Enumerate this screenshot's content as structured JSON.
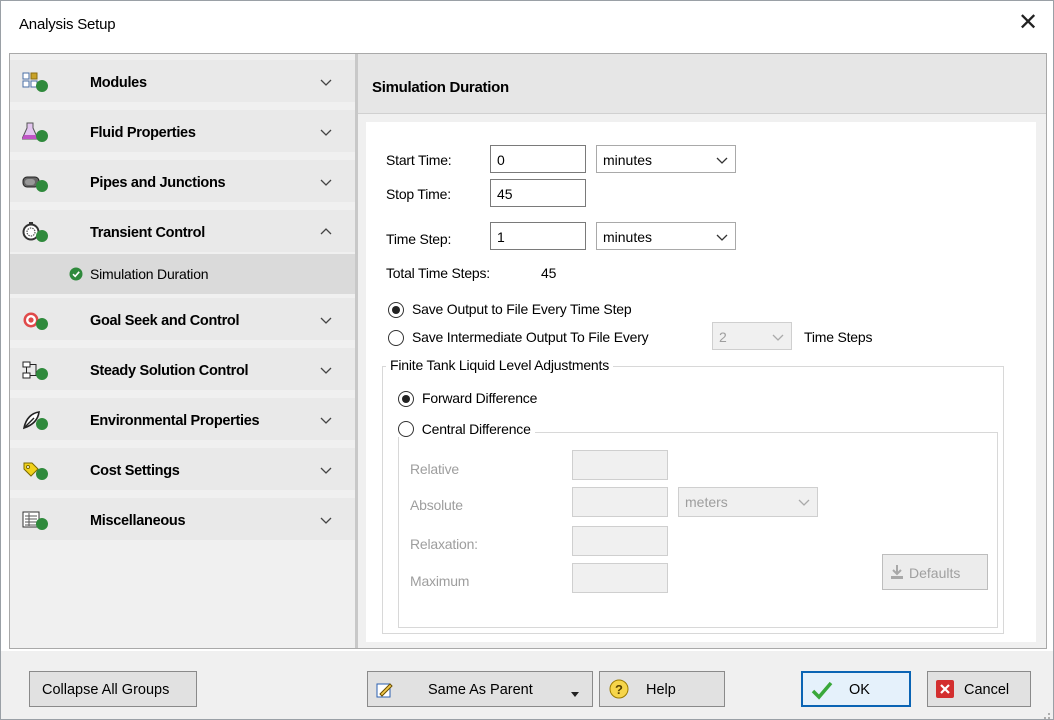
{
  "window": {
    "title": "Analysis Setup"
  },
  "sidebar": {
    "items": [
      {
        "label": "Modules",
        "icon": "modules-icon",
        "expanded": false
      },
      {
        "label": "Fluid Properties",
        "icon": "flask-icon",
        "expanded": false
      },
      {
        "label": "Pipes and Junctions",
        "icon": "pipe-icon",
        "expanded": false
      },
      {
        "label": "Transient Control",
        "icon": "stopwatch-icon",
        "expanded": true
      },
      {
        "label": "Goal Seek and Control",
        "icon": "target-icon",
        "expanded": false
      },
      {
        "label": "Steady Solution Control",
        "icon": "solver-icon",
        "expanded": false
      },
      {
        "label": "Environmental Properties",
        "icon": "environment-icon",
        "expanded": false
      },
      {
        "label": "Cost Settings",
        "icon": "cost-icon",
        "expanded": false
      },
      {
        "label": "Miscellaneous",
        "icon": "misc-icon",
        "expanded": false
      }
    ],
    "subitem": {
      "label": "Simulation Duration",
      "selected": true
    }
  },
  "main": {
    "heading": "Simulation Duration",
    "start_time": {
      "label": "Start Time:",
      "value": "0",
      "unit": "minutes"
    },
    "stop_time": {
      "label": "Stop Time:",
      "value": "45"
    },
    "time_step": {
      "label": "Time Step:",
      "value": "1",
      "unit": "minutes"
    },
    "total_steps": {
      "label": "Total Time Steps:",
      "value": "45"
    },
    "output": {
      "option1": "Save Output to File Every Time Step",
      "option2": "Save Intermediate Output To File Every",
      "interval_value": "2",
      "interval_unit": "Time Steps",
      "selected": "option1"
    },
    "finite_tank": {
      "title": "Finite Tank Liquid Level Adjustments",
      "forward": "Forward Difference",
      "central": "Central Difference",
      "selected": "forward",
      "relative_label": "Relative",
      "absolute_label": "Absolute",
      "absolute_unit": "meters",
      "relaxation_label": "Relaxation:",
      "maximum_label": "Maximum",
      "defaults_label": "Defaults"
    }
  },
  "footer": {
    "collapse_label": "Collapse All Groups",
    "same_as_parent_label": "Same As Parent",
    "help_label": "Help",
    "ok_label": "OK",
    "cancel_label": "Cancel"
  },
  "colors": {
    "check_green": "#2f8a3c",
    "cancel_red": "#d32f2f",
    "ok_border": "#0a64b4"
  }
}
